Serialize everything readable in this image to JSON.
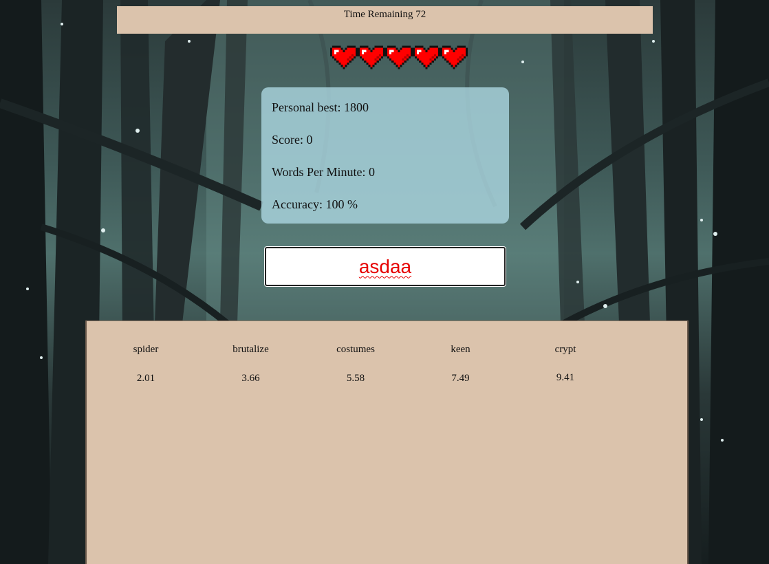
{
  "timer": {
    "label": "Time Remaining 72"
  },
  "lives": {
    "count": 5,
    "icon": "heart-icon",
    "color": "#ff0000"
  },
  "stats": {
    "personal_best": "Personal best: 1800",
    "score": "Score: 0",
    "wpm": "Words Per Minute: 0",
    "accuracy": "Accuracy: 100 %"
  },
  "typing": {
    "value": "asdaa",
    "color": "#e60000"
  },
  "words": [
    {
      "word": "spider",
      "time": "2.01"
    },
    {
      "word": "brutalize",
      "time": "3.66"
    },
    {
      "word": "costumes",
      "time": "5.58"
    },
    {
      "word": "keen",
      "time": "7.49"
    },
    {
      "word": "crypt",
      "time": "9.41"
    }
  ],
  "colors": {
    "panel_tan": "#dbc3ac",
    "stats_blue": "#aad4de"
  }
}
